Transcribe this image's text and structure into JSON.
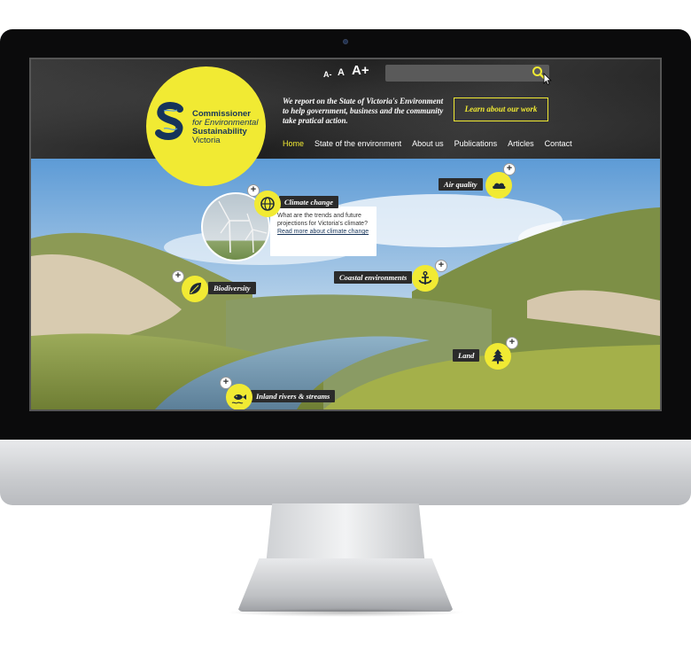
{
  "font_controls": {
    "small": "A-",
    "medium": "A",
    "large": "A+"
  },
  "search": {
    "placeholder": ""
  },
  "logo": {
    "line1": "Commissioner",
    "line2": "for Environmental",
    "line3": "Sustainability",
    "line4": "Victoria"
  },
  "tagline": "We report on the State of Victoria's Environment to help government, business and the community take pratical action.",
  "cta": {
    "label": "Learn about our work"
  },
  "nav": {
    "items": [
      {
        "label": "Home",
        "active": true
      },
      {
        "label": "State of the environment"
      },
      {
        "label": "About us"
      },
      {
        "label": "Publications"
      },
      {
        "label": "Articles"
      },
      {
        "label": "Contact"
      }
    ]
  },
  "hotspots": {
    "air_quality": "Air quality",
    "climate_change": "Climate change",
    "coastal": "Coastal environments",
    "biodiversity": "Biodiversity",
    "land": "Land",
    "rivers": "Inland rivers & streams"
  },
  "climate_info": {
    "text": "What are the trends and future projections for Victoria's climate?",
    "link": "Read more about climate change"
  },
  "colors": {
    "accent": "#f1ea33",
    "navy": "#16345a",
    "pill": "#2b2b2b"
  }
}
